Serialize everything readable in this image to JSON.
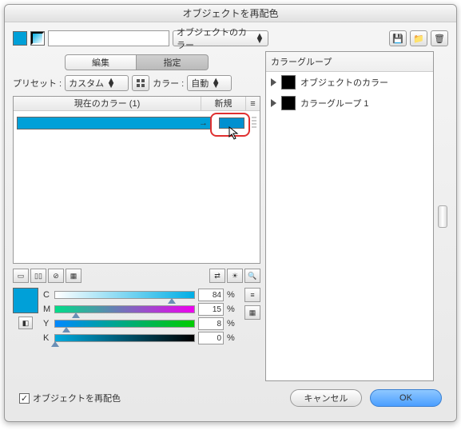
{
  "title": "オブジェクトを再配色",
  "object_color_label": "オブジェクトのカラー",
  "tabs": {
    "edit": "編集",
    "assign": "指定"
  },
  "preset": {
    "label": "プリセット :",
    "value": "カスタム"
  },
  "color": {
    "label": "カラー :",
    "value": "自動"
  },
  "list": {
    "current": "現在のカラー (1)",
    "new": "新規",
    "menu": "≡"
  },
  "sliders": {
    "C": {
      "label": "C",
      "value": 84,
      "pct": "%"
    },
    "M": {
      "label": "M",
      "value": 15,
      "pct": "%"
    },
    "Y": {
      "label": "Y",
      "value": 8,
      "pct": "%"
    },
    "K": {
      "label": "K",
      "value": 0,
      "pct": "%"
    }
  },
  "color_groups": {
    "title": "カラーグループ",
    "items": [
      "オブジェクトのカラー",
      "カラーグループ 1"
    ]
  },
  "recolor_check": "オブジェクトを再配色",
  "buttons": {
    "cancel": "キャンセル",
    "ok": "OK"
  },
  "icons": {
    "arrow": "→",
    "save": "💾",
    "folder": "📁",
    "trash": "🗑",
    "check": "✓"
  }
}
